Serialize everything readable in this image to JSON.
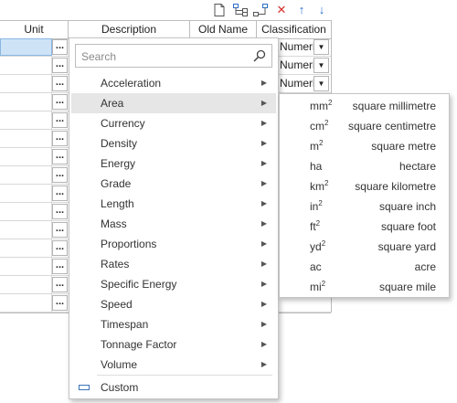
{
  "toolbar": {
    "icons": [
      "new-document-icon",
      "add-child-icon",
      "add-sibling-icon",
      "delete-icon",
      "move-up-icon",
      "move-down-icon"
    ],
    "delete_glyph": "✕",
    "up_glyph": "↑",
    "down_glyph": "↓",
    "colors": {
      "delete": "#d9302c",
      "arrows": "#2a6fc9"
    }
  },
  "grid": {
    "columns": [
      "Unit",
      "Description",
      "Old Name",
      "Classification"
    ],
    "ellipsis": "...",
    "classification_values": [
      "Numeric",
      "Numeric",
      "Numeric"
    ],
    "row_count": 15
  },
  "menu": {
    "search_placeholder": "Search",
    "items": [
      "Acceleration",
      "Area",
      "Currency",
      "Density",
      "Energy",
      "Grade",
      "Length",
      "Mass",
      "Proportions",
      "Rates",
      "Specific Energy",
      "Speed",
      "Timespan",
      "Tonnage Factor",
      "Volume"
    ],
    "highlighted": "Area",
    "arrow_glyph": "▶",
    "custom_label": "Custom"
  },
  "submenu": {
    "items": [
      {
        "base": "mm",
        "exp": "2",
        "name": "square millimetre"
      },
      {
        "base": "cm",
        "exp": "2",
        "name": "square centimetre"
      },
      {
        "base": "m",
        "exp": "2",
        "name": "square metre"
      },
      {
        "base": "ha",
        "exp": "",
        "name": "hectare"
      },
      {
        "base": "km",
        "exp": "2",
        "name": "square kilometre"
      },
      {
        "base": "in",
        "exp": "2",
        "name": "square inch"
      },
      {
        "base": "ft",
        "exp": "2",
        "name": "square foot"
      },
      {
        "base": "yd",
        "exp": "2",
        "name": "square yard"
      },
      {
        "base": "ac",
        "exp": "",
        "name": "acre"
      },
      {
        "base": "mi",
        "exp": "2",
        "name": "square mile"
      }
    ]
  }
}
